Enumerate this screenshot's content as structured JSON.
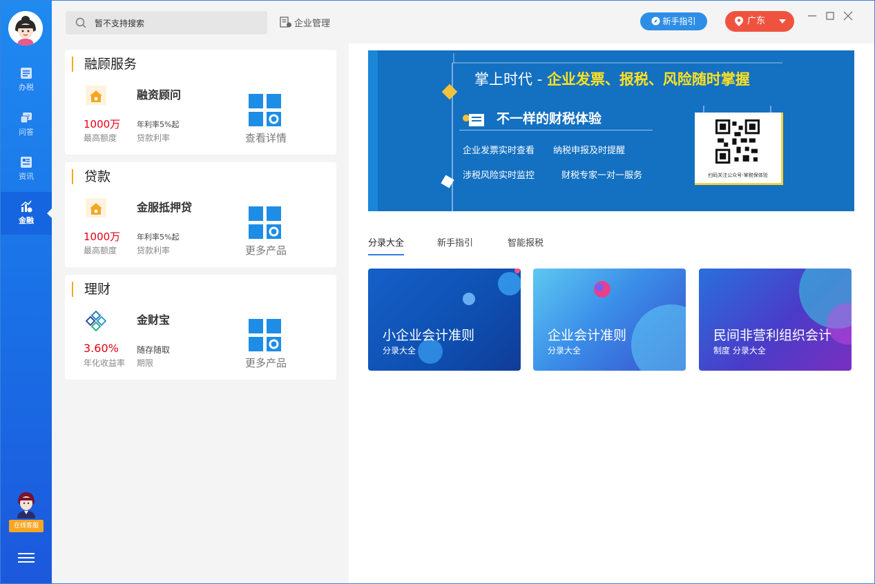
{
  "search": {
    "placeholder": "暂不支持搜索"
  },
  "header": {
    "enterprise_label": "企业管理",
    "guide_label": "新手指引",
    "region_label": "广东"
  },
  "sidebar": {
    "items": [
      {
        "label": "办税",
        "icon": "tax-icon"
      },
      {
        "label": "问答",
        "icon": "qa-icon"
      },
      {
        "label": "资讯",
        "icon": "news-icon"
      },
      {
        "label": "金融",
        "icon": "finance-icon"
      }
    ],
    "service_label": "在线客服"
  },
  "cards": [
    {
      "title": "融顾服务",
      "product": "融资顾问",
      "amount": "1000万",
      "amount_label": "最高额度",
      "rate": "年利率5%起",
      "rate_label": "贷款利率",
      "more": "查看详情"
    },
    {
      "title": "贷款",
      "product": "金服抵押贷",
      "amount": "1000万",
      "amount_label": "最高额度",
      "rate": "年利率5%起",
      "rate_label": "贷款利率",
      "more": "更多产品"
    },
    {
      "title": "理财",
      "product": "金财宝",
      "amount": "3.60%",
      "amount_label": "年化收益率",
      "rate": "随存随取",
      "rate_label": "期限",
      "more": "更多产品"
    }
  ],
  "banner": {
    "title_prefix": "掌上时代 - ",
    "title_highlight": "企业发票、报税、风险随时掌握",
    "subtitle": "不一样的财税体验",
    "features": [
      "企业发票实时查看",
      "纳税申报及时提醒",
      "涉税风险实时监控",
      "财税专家一对一服务"
    ],
    "qr_caption": "扫码关注公众号-掌税保体验"
  },
  "tabs": [
    "分录大全",
    "新手指引",
    "智能报税"
  ],
  "tiles": [
    {
      "title": "小企业会计准则",
      "sub": "分录大全"
    },
    {
      "title": "企业会计准则",
      "sub": "分录大全"
    },
    {
      "title": "民间非营利组织会计",
      "sub": "制度 分录大全"
    }
  ],
  "colors": {
    "accent": "#2d7be5",
    "sidebar": "#1a6fe6",
    "highlight": "#e60012",
    "region": "#ef5340",
    "banner": "#1470c1"
  }
}
